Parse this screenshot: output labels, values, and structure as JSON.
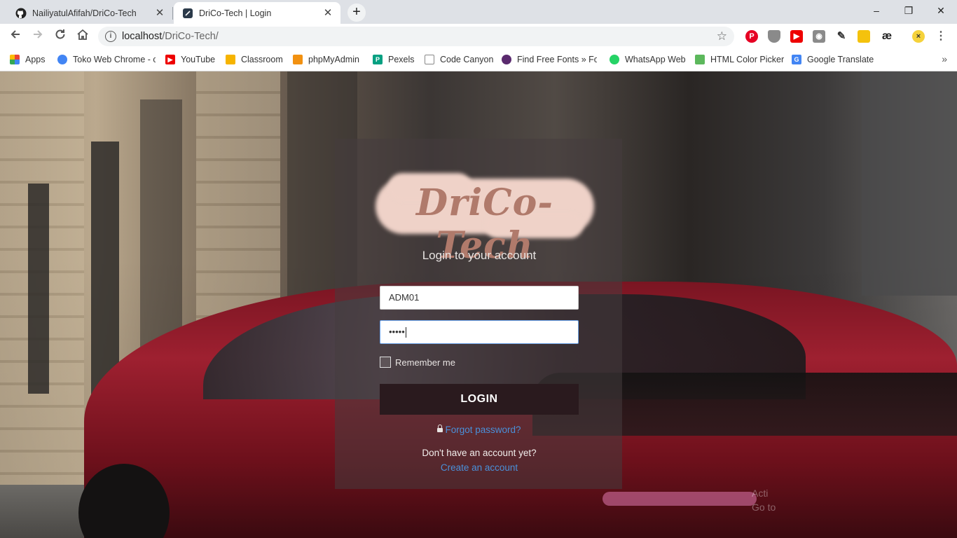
{
  "browser": {
    "tabs": [
      {
        "title": "NailiyatulAfifah/DriCo-Tech",
        "favicon": "github-icon",
        "active": false
      },
      {
        "title": "DriCo-Tech | Login",
        "favicon": "page-icon",
        "active": true
      }
    ],
    "new_tab_label": "+",
    "window_controls": {
      "minimize": "–",
      "maximize": "❐",
      "close": "✕"
    },
    "tab_close": "✕",
    "url_host": "localhost",
    "url_path": "/DriCo-Tech/",
    "extensions": [
      {
        "name": "pinterest-icon",
        "color": "#e60023"
      },
      {
        "name": "shield-icon",
        "color": "#8a8a8a"
      },
      {
        "name": "youtube-icon",
        "color": "#e00"
      },
      {
        "name": "camera-icon",
        "color": "#8a8a8a"
      },
      {
        "name": "pen-icon",
        "color": "#444"
      },
      {
        "name": "extension-yellow-icon",
        "color": "#f4c20d"
      },
      {
        "name": "ae-icon",
        "color": "#333"
      },
      {
        "name": "profile-icon",
        "color": "#f5d23b"
      }
    ],
    "bookmarks": [
      {
        "label": "Apps",
        "icon": "apps-icon",
        "color": "#ea4335"
      },
      {
        "label": "Toko Web Chrome - c",
        "icon": "chrome-store-icon",
        "color": "#4285f4"
      },
      {
        "label": "YouTube",
        "icon": "youtube-icon",
        "color": "#e00"
      },
      {
        "label": "Classroom",
        "icon": "classroom-icon",
        "color": "#f6b400"
      },
      {
        "label": "phpMyAdmin",
        "icon": "phpmyadmin-icon",
        "color": "#f29111"
      },
      {
        "label": "Pexels",
        "icon": "pexels-icon",
        "color": "#05a081"
      },
      {
        "label": "Code Canyon",
        "icon": "page-icon",
        "color": "#ffffff"
      },
      {
        "label": "Find Free Fonts » Fon",
        "icon": "fonts-icon",
        "color": "#5a2a6e"
      },
      {
        "label": "WhatsApp Web",
        "icon": "whatsapp-icon",
        "color": "#25d366"
      },
      {
        "label": "HTML Color Picker",
        "icon": "color-picker-icon",
        "color": "#5cb85c"
      },
      {
        "label": "Google Translate",
        "icon": "translate-icon",
        "color": "#4285f4"
      }
    ],
    "bookmarks_more": "»"
  },
  "login": {
    "logo_text": "DriCo-Tech",
    "subtitle": "Login to your account",
    "username_value": "ADM01",
    "password_mask": "•••••",
    "remember_label": "Remember me",
    "login_button": "LOGIN",
    "forgot_label": "Forgot password?",
    "no_account_text": "Don't have an account yet?",
    "create_label": "Create an account"
  },
  "watermark": {
    "line1": "Acti",
    "line2": "Go to"
  },
  "colors": {
    "accent_link": "#4a90d9",
    "button_dark": "#2a1a1e",
    "logo_text": "#b07a6b",
    "logo_cloud": "#efd2c8"
  }
}
